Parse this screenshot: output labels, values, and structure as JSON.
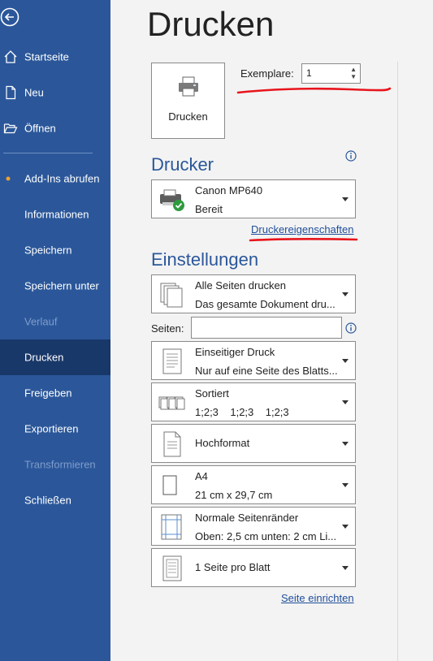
{
  "sidebar": {
    "items": [
      {
        "label": "Startseite"
      },
      {
        "label": "Neu"
      },
      {
        "label": "Öffnen"
      },
      {
        "label": "Add-Ins abrufen"
      },
      {
        "label": "Informationen"
      },
      {
        "label": "Speichern"
      },
      {
        "label": "Speichern unter"
      },
      {
        "label": "Verlauf"
      },
      {
        "label": "Drucken"
      },
      {
        "label": "Freigeben"
      },
      {
        "label": "Exportieren"
      },
      {
        "label": "Transformieren"
      },
      {
        "label": "Schließen"
      }
    ]
  },
  "page": {
    "title": "Drucken"
  },
  "print_button": {
    "label": "Drucken"
  },
  "copies": {
    "label": "Exemplare:",
    "value": "1"
  },
  "printer": {
    "section_title": "Drucker",
    "name": "Canon MP640",
    "status": "Bereit",
    "properties_link": "Druckereigenschaften"
  },
  "settings": {
    "section_title": "Einstellungen",
    "pages_label": "Seiten:",
    "pages_value": "",
    "range": {
      "line1": "Alle Seiten drucken",
      "line2": "Das gesamte Dokument dru..."
    },
    "sides": {
      "line1": "Einseitiger Druck",
      "line2": "Nur auf eine Seite des Blatts..."
    },
    "collation": {
      "line1": "Sortiert",
      "line2": "1;2;3    1;2;3    1;2;3"
    },
    "orientation": {
      "line1": "Hochformat"
    },
    "paper": {
      "line1": "A4",
      "line2": "21 cm x 29,7 cm"
    },
    "margins": {
      "line1": "Normale Seitenränder",
      "line2": "Oben: 2,5 cm unten: 2 cm Li..."
    },
    "per_sheet": {
      "line1": "1 Seite pro Blatt"
    },
    "page_setup_link": "Seite einrichten"
  },
  "colors": {
    "sidebar": "#2b579a",
    "sidebar_active": "#19386a",
    "accent": "#2b579a",
    "annotation": "#e8141c"
  }
}
